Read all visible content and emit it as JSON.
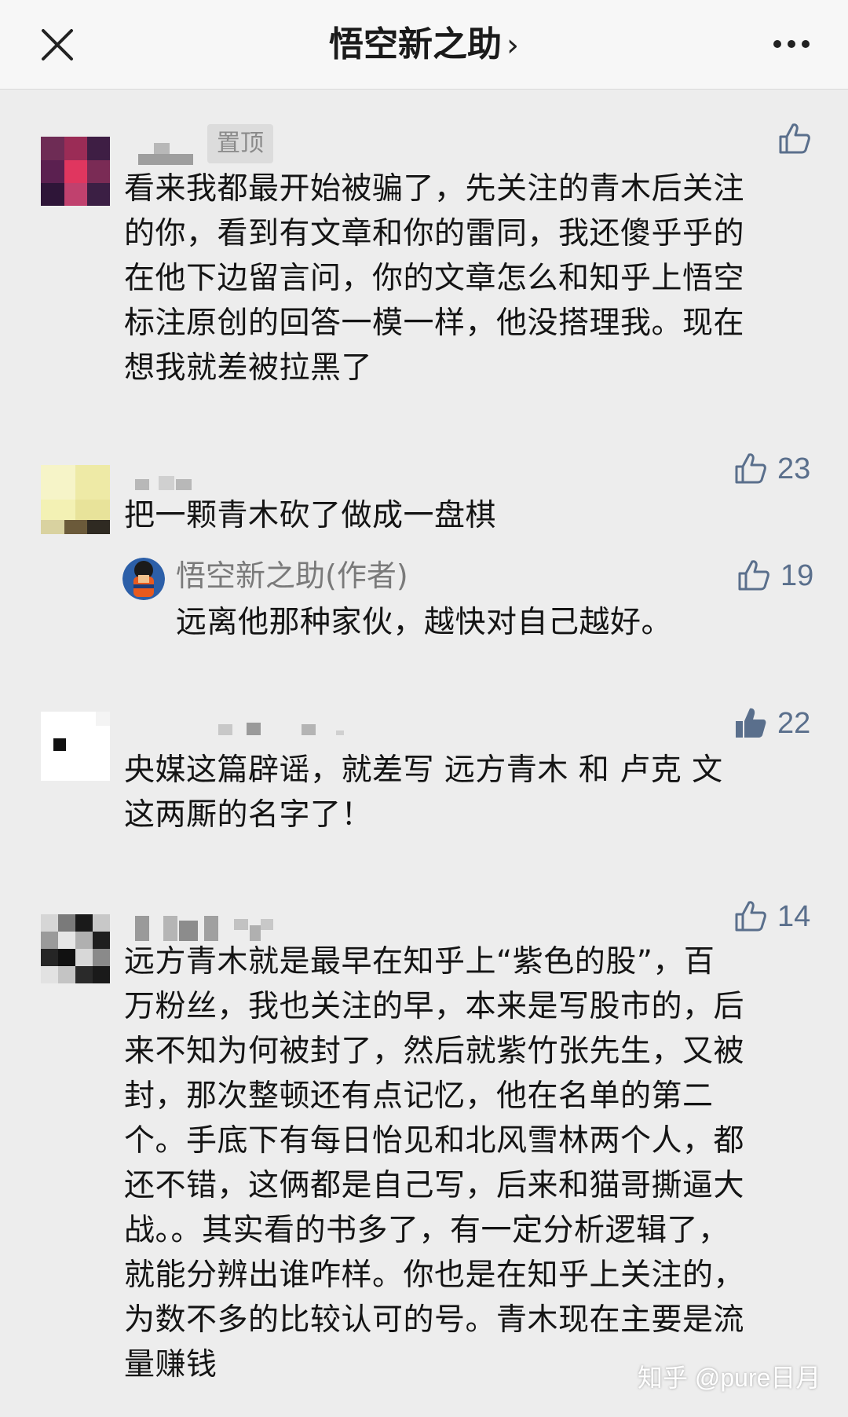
{
  "header": {
    "title": "悟空新之助",
    "chevron": "›",
    "close_icon": "close-icon",
    "more_icon": "more-icon"
  },
  "comments": [
    {
      "pinned_label": "置顶",
      "text_lines": [
        "看来我都最开始被骗了，先关注的青木后关注",
        "的你，看到有文章和你的雷同，我还傻乎乎的",
        "在他下边留言问，你的文章怎么和知乎上悟空",
        "标注原创的回答一模一样，他没搭理我。现在",
        "想我就差被拉黑了"
      ],
      "like_icon": "thumbs-up-outline-icon"
    },
    {
      "text_lines": [
        "把一颗青木砍了做成一盘棋"
      ],
      "likes": "23",
      "like_icon": "thumbs-up-outline-icon",
      "reply": {
        "author": "悟空新之助(作者)",
        "text": "远离他那种家伙，越快对自己越好。",
        "likes": "19",
        "like_icon": "thumbs-up-outline-icon"
      }
    },
    {
      "text_lines": [
        "央媒这篇辟谣，就差写 远方青木 和 卢克 文",
        "这两厮的名字了！"
      ],
      "likes": "22",
      "like_icon": "thumbs-up-filled-icon"
    },
    {
      "text_lines": [
        "远方青木就是最早在知乎上“紫色的股”，百",
        "万粉丝，我也关注的早，本来是写股市的，后",
        "来不知为何被封了，然后就紫竹张先生，又被",
        "封，那次整顿还有点记忆，他在名单的第二",
        "个。手底下有每日怡见和北风雪林两个人，都",
        "还不错，这俩都是自己写，后来和猫哥撕逼大",
        "战。。其实看的书多了，有一定分析逻辑了，",
        "就能分辨出谁咋样。你也是在知乎上关注的，",
        "为数不多的比较认可的号。青木现在主要是流",
        "量赚钱"
      ],
      "likes": "14",
      "like_icon": "thumbs-up-outline-icon"
    }
  ],
  "watermark": "知乎 @pure日月",
  "colors": {
    "background": "#ededed",
    "header_bg": "#f7f7f7",
    "like_color": "#5a6f8c",
    "text": "#141414"
  }
}
